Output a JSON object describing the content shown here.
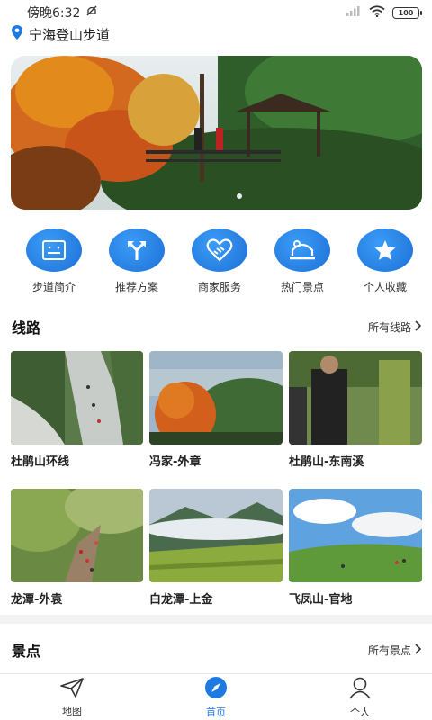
{
  "status_bar": {
    "time": "傍晚6:32",
    "battery": "100"
  },
  "location": {
    "name": "宁海登山步道"
  },
  "menu": [
    {
      "label": "步道简介",
      "icon": "intro-icon"
    },
    {
      "label": "推荐方案",
      "icon": "route-split-icon"
    },
    {
      "label": "商家服务",
      "icon": "handshake-icon"
    },
    {
      "label": "热门景点",
      "icon": "attraction-icon"
    },
    {
      "label": "个人收藏",
      "icon": "star-icon"
    }
  ],
  "routes_section": {
    "title": "线路",
    "more": "所有线路",
    "items": [
      {
        "name": "杜鹃山环线"
      },
      {
        "name": "冯家-外章"
      },
      {
        "name": "杜鹃山-东南溪"
      },
      {
        "name": "龙潭-外袁"
      },
      {
        "name": "白龙潭-上金"
      },
      {
        "name": "飞凤山-官地"
      }
    ]
  },
  "spots_section": {
    "title": "景点",
    "more": "所有景点"
  },
  "bottom_nav": {
    "items": [
      {
        "label": "地图",
        "icon": "paper-plane-icon",
        "active": false
      },
      {
        "label": "首页",
        "icon": "compass-icon",
        "active": true
      },
      {
        "label": "个人",
        "icon": "person-icon",
        "active": false
      }
    ]
  },
  "colors": {
    "accent": "#1e7ae0",
    "divider": "#f2f2f4"
  }
}
